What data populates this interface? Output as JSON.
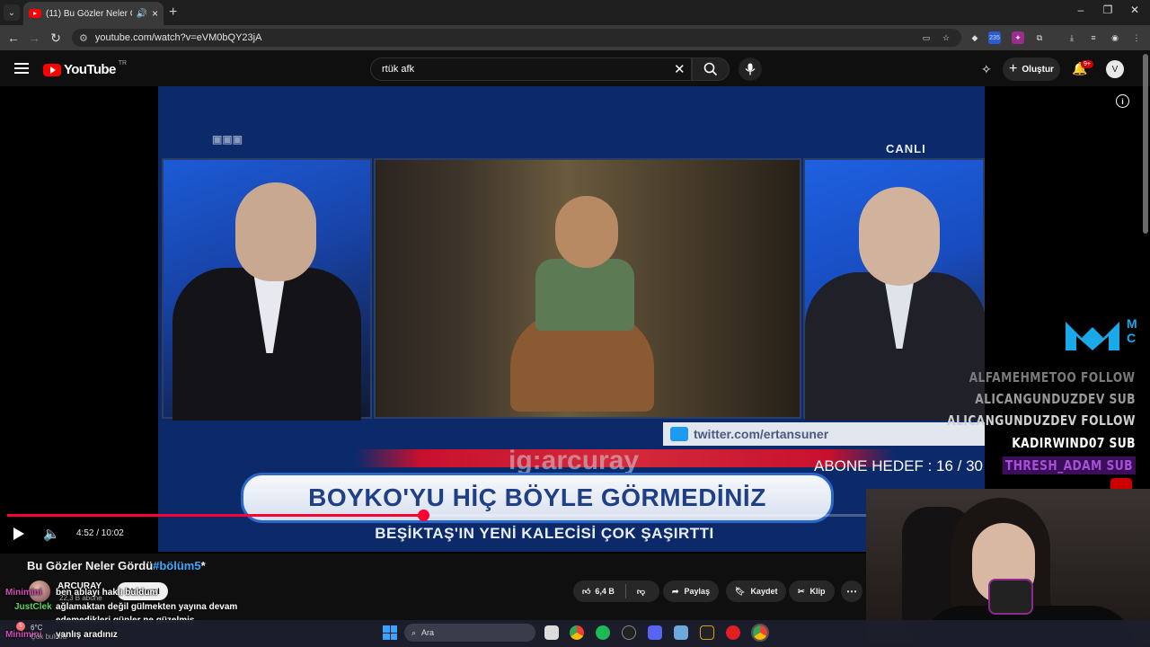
{
  "browser": {
    "tab_title": "(11) Bu Gözler Neler Gördü",
    "url": "youtube.com/watch?v=eVM0bQY23jA",
    "extension_badge": "235"
  },
  "header": {
    "logo_text": "YouTube",
    "country_code": "TR",
    "search_value": "rtük afk",
    "create_label": "Oluştur",
    "notification_count": "9+"
  },
  "video": {
    "tv_live_label": "CANLI",
    "tv_twitter_handle": "twitter.com/ertansuner",
    "tv_watermark": "ig:arcuray",
    "tv_headline": "BOYKO'YU HİÇ BÖYLE GÖRMEDİNİZ",
    "tv_subline": "BEŞİKTAŞ'IN YENİ KALECİSİ ÇOK ŞAŞIRTTI",
    "current_time": "4:52",
    "duration": "10:02",
    "time_display": "4:52 / 10:02",
    "progress": 0.4847
  },
  "overlay": {
    "follow_lines": [
      "ALFAMEHMETOO FOLLOW",
      "ALICANGUNDUZDEV SUB",
      "ALICANGUNDUZDEV FOLLOW",
      "KADIRWIND07 SUB",
      "THRESH_ADAM SUB"
    ],
    "abone_hedef": "ABONE HEDEF : 16 / 30"
  },
  "below": {
    "title_main": "Bu Gözler Neler Gördü",
    "title_tag": "#bölüm5",
    "title_suffix": "*",
    "channel_name": "ARCURAY",
    "subscriber_count": "22,3 B abone",
    "subscribe_label": "Abone ol",
    "like_count": "6,4 B",
    "share_label": "Paylaş",
    "save_label": "Kaydet",
    "clip_label": "Klip",
    "more_label": "⋯"
  },
  "chat": [
    {
      "user": "Minimini",
      "message": "ben ablayı haklı buldum"
    },
    {
      "user": "JustClek",
      "message_lines": [
        "ağlamaktan değil gülmekten yayına devam",
        "edemedikleri günler ne güzelmiş",
        "yanlış aradınız"
      ]
    },
    {
      "user": "Minimini"
    }
  ],
  "taskbar": {
    "weather_temp": "6°C",
    "weather_desc": "Çok bulutlu",
    "weather_badge": "5",
    "search_placeholder": "Ara"
  },
  "colors": {
    "yt_red": "#ff0000",
    "progress_red": "#ff0033",
    "link_blue": "#3ea6ff",
    "thresh_purple": "#a64fd8"
  }
}
